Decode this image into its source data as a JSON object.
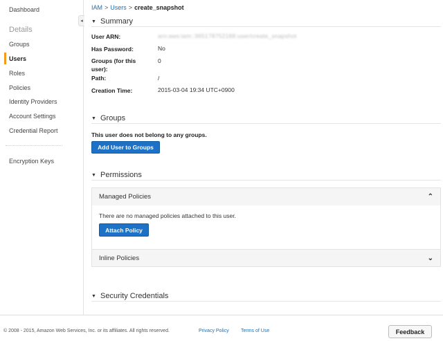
{
  "sidebar": {
    "dashboard": "Dashboard",
    "heading": "Details",
    "items": [
      {
        "label": "Groups"
      },
      {
        "label": "Users"
      },
      {
        "label": "Roles"
      },
      {
        "label": "Policies"
      },
      {
        "label": "Identity Providers"
      },
      {
        "label": "Account Settings"
      },
      {
        "label": "Credential Report"
      }
    ],
    "encryption": "Encryption Keys",
    "collapse_icon": "◂"
  },
  "breadcrumb": {
    "root": "IAM",
    "users": "Users",
    "sep": ">",
    "current": "create_snapshot"
  },
  "summary": {
    "title": "Summary",
    "rows": [
      {
        "label": "User ARN:",
        "value": "arn:aws:iam::365178752188:user/create_snapshot"
      },
      {
        "label": "Has Password:",
        "value": "No"
      },
      {
        "label": "Groups (for this user):",
        "value": "0"
      },
      {
        "label": "Path:",
        "value": "/"
      },
      {
        "label": "Creation Time:",
        "value": "2015-03-04 19:34 UTC+0900"
      }
    ]
  },
  "groups": {
    "title": "Groups",
    "message": "This user does not belong to any groups.",
    "button": "Add User to Groups"
  },
  "permissions": {
    "title": "Permissions",
    "managed_title": "Managed Policies",
    "managed_message": "There are no managed policies attached to this user.",
    "attach_button": "Attach Policy",
    "inline_title": "Inline Policies",
    "chev_up": "⌃",
    "chev_down": "⌄"
  },
  "security": {
    "title": "Security Credentials"
  },
  "section_icon": "▼",
  "footer": {
    "copyright": "© 2008 - 2015, Amazon Web Services, Inc. or its affiliates. All rights reserved.",
    "privacy": "Privacy Policy",
    "terms": "Terms of Use",
    "feedback": "Feedback"
  }
}
